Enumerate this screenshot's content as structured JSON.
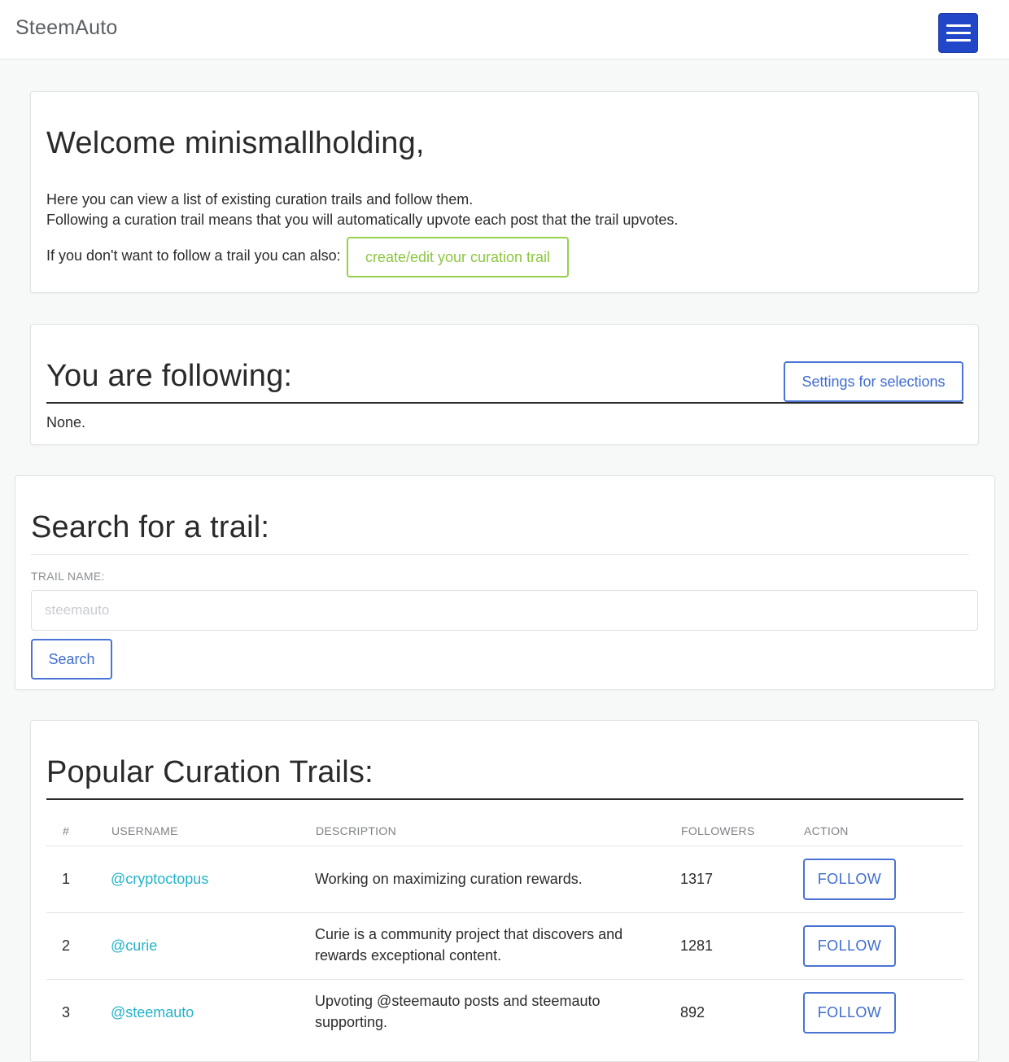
{
  "navbar": {
    "brand": "SteemAuto",
    "menu_icon": "hamburger-menu-icon"
  },
  "welcome": {
    "title": "Welcome minismallholding,",
    "line1": "Here you can view a list of existing curation trails and follow them.",
    "line2": "Following a curation trail means that you will automatically upvote each post that the trail upvotes.",
    "line3": "If you don't want to follow a trail you can also:",
    "create_button": "create/edit your curation trail"
  },
  "following": {
    "title": "You are following:",
    "settings_button": "Settings for selections",
    "value": "None."
  },
  "search": {
    "title": "Search for a trail:",
    "field_label": "TRAIL NAME:",
    "placeholder": "steemauto",
    "button": "Search"
  },
  "popular": {
    "title": "Popular Curation Trails:",
    "columns": [
      "#",
      "USERNAME",
      "DESCRIPTION",
      "FOLLOWERS",
      "ACTION"
    ],
    "rows": [
      {
        "num": "1",
        "username": "@cryptoctopus",
        "description": "Working on maximizing curation rewards.",
        "followers": "1317",
        "action": "FOLLOW"
      },
      {
        "num": "2",
        "username": "@curie",
        "description": "Curie is a community project that discovers and rewards exceptional content.",
        "followers": "1281",
        "action": "FOLLOW"
      },
      {
        "num": "3",
        "username": "@steemauto",
        "description": "Upvoting @steemauto posts and steemauto supporting.",
        "followers": "892",
        "action": "FOLLOW"
      }
    ]
  },
  "colors": {
    "primary": "#2146c7",
    "outline_blue": "#4a74d4",
    "outline_green": "#95d14b",
    "link_teal": "#22b3c9"
  }
}
